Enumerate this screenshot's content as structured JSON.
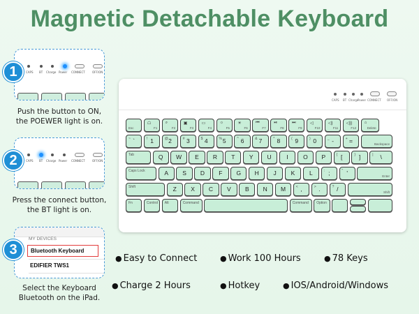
{
  "title": "Magnetic Detachable Keyboard",
  "colors": {
    "title": "#4e8f64",
    "step_badge": "#1f8fd6",
    "key_fill": "#c8eed8",
    "highlight": "#e23b3b"
  },
  "indicators": {
    "caps": "CAPS",
    "bt": "BT",
    "charge": "Charge",
    "power": "Power",
    "connect": "CONNECT",
    "offon": "OFF/ON"
  },
  "steps": [
    {
      "number": "1",
      "caption_line1": "Push the button to ON,",
      "caption_line2": "the POEWER light is on."
    },
    {
      "number": "2",
      "caption_line1": "Press the connect button,",
      "caption_line2": "the BT light is on."
    },
    {
      "number": "3",
      "caption_line1": "Select the Keyboard",
      "caption_line2": "Bluetooth on the iPad.",
      "devices_header": "MY DEVICES",
      "device_selected": "Bluetooth Keyboard",
      "device_other": "EDIFIER TWS1"
    }
  ],
  "keyboard": {
    "fn_row": [
      {
        "ic": "☖",
        "f": "F1"
      },
      {
        "ic": "⌕",
        "f": "F2"
      },
      {
        "ic": "▣",
        "f": "F3"
      },
      {
        "ic": "▭",
        "f": "F4"
      },
      {
        "ic": "☼",
        "f": "F5"
      },
      {
        "ic": "☀",
        "f": "F6"
      },
      {
        "ic": "⏮",
        "f": "F7"
      },
      {
        "ic": "⏯",
        "f": "F8"
      },
      {
        "ic": "⏭",
        "f": "F9"
      },
      {
        "ic": "◁",
        "f": "F10"
      },
      {
        "ic": "◁)",
        "f": "F11"
      },
      {
        "ic": "◁))",
        "f": "F12"
      },
      {
        "ic": "⌂",
        "f": "Delete"
      }
    ],
    "esc_key": "Esc",
    "number_row": [
      {
        "s": "~",
        "m": "`"
      },
      {
        "s": "!",
        "m": "1"
      },
      {
        "s": "@",
        "m": "2"
      },
      {
        "s": "#",
        "m": "3"
      },
      {
        "s": "$",
        "m": "4"
      },
      {
        "s": "%",
        "m": "5"
      },
      {
        "s": "^",
        "m": "6"
      },
      {
        "s": "&",
        "m": "7"
      },
      {
        "s": "*",
        "m": "8"
      },
      {
        "s": "(",
        "m": "9"
      },
      {
        "s": ")",
        "m": "0"
      },
      {
        "s": "_",
        "m": "-"
      },
      {
        "s": "+",
        "m": "="
      }
    ],
    "backspace": "Backspace",
    "tab": "Tab",
    "q_row": [
      "Q",
      "W",
      "E",
      "R",
      "T",
      "Y",
      "U",
      "I",
      "O",
      "P"
    ],
    "brackets": [
      {
        "s": "{",
        "m": "["
      },
      {
        "s": "}",
        "m": "]"
      },
      {
        "s": "|",
        "m": "\\"
      }
    ],
    "caps": "Caps Lock",
    "a_row": [
      "A",
      "S",
      "D",
      "F",
      "G",
      "H",
      "J",
      "K",
      "L"
    ],
    "a_row_punct": [
      {
        "s": ":",
        "m": ";"
      },
      {
        "s": "\"",
        "m": "'"
      }
    ],
    "enter": "Enter",
    "shift": "Shift",
    "z_row": [
      "Z",
      "X",
      "C",
      "V",
      "B",
      "N",
      "M"
    ],
    "z_row_punct": [
      {
        "s": "<",
        "m": ","
      },
      {
        "s": ">",
        "m": "."
      },
      {
        "s": "?",
        "m": "/"
      }
    ],
    "bottom": {
      "fn": "Fn",
      "control": "Control",
      "alt": "Alt",
      "option": "Option",
      "command": "Command"
    }
  },
  "features": [
    "Easy to Connect",
    "Work 100 Hours",
    "78 Keys",
    "Charge 2 Hours",
    "Hotkey",
    "IOS/Android/Windows"
  ]
}
